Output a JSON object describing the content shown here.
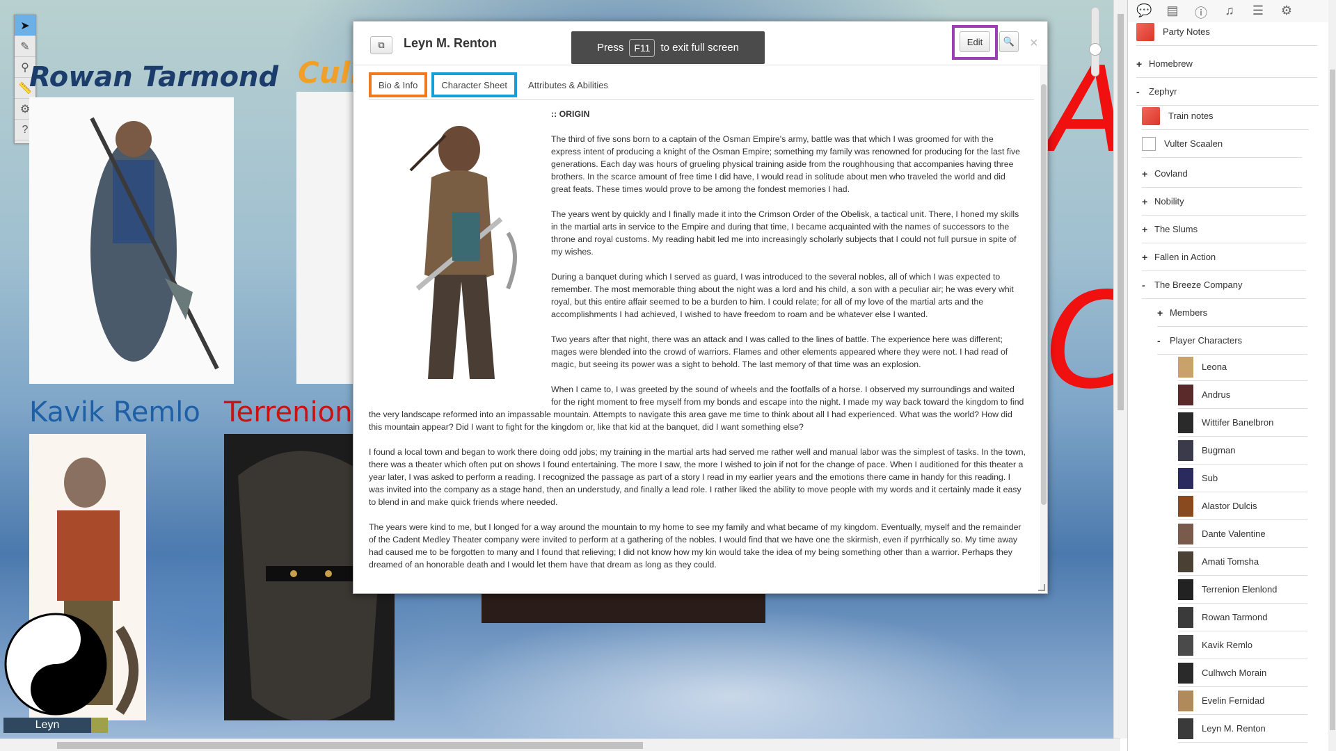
{
  "map": {
    "tokens": [
      {
        "name": "Rowan Tarmond",
        "color": "#1c3d6b"
      },
      {
        "name": "Culhv",
        "color": "#f0a028"
      },
      {
        "name": "Kavik Remlo",
        "color": "#1f5fa6"
      },
      {
        "name": "Terrenion E",
        "color": "#cc1111"
      }
    ],
    "player_token_label": "Leyn",
    "red_scrawl_1": "Al",
    "red_scrawl_2": "Co"
  },
  "fullscreen_banner": {
    "press": "Press",
    "key": "F11",
    "rest": "to exit full screen"
  },
  "handout": {
    "title": "Leyn M. Renton",
    "edit_label": "Edit",
    "close_glyph": "×",
    "tabs": [
      "Bio & Info",
      "Character Sheet",
      "Attributes & Abilities"
    ],
    "section_heading": ":: ORIGIN",
    "paragraphs": [
      "The third of five sons born to a captain of the Osman Empire's army, battle was that which I was groomed for with the express intent of producing a knight of the Osman Empire; something my family was renowned for producing for the last five generations. Each day was hours of grueling physical training aside from the roughhousing that accompanies having three brothers. In the scarce amount of free time I did have, I would read in solitude about men who traveled the world and did great feats. These times would prove to be among the fondest memories I had.",
      "The years went by quickly and I finally made it into the Crimson Order of the Obelisk, a tactical unit. There, I honed my skills in the martial arts in service to the Empire and during that time, I became acquainted with the names of successors to the throne and royal customs. My reading habit led me into increasingly scholarly subjects that I could not full pursue in spite of my wishes.",
      "During a banquet during which I served as guard, I was introduced to the several nobles, all of which I was expected to remember. The most memorable thing about the night was a lord and his child, a son with a peculiar air; he was every whit royal, but this entire affair seemed to be a burden to him. I could relate; for all of my love of the martial arts and the accomplishments I had achieved, I wished to have freedom to roam and be whatever else I wanted.",
      "Two years after that night, there was an attack and I was called to the lines of battle. The experience here was different; mages were blended into the crowd of warriors. Flames and other elements appeared where they were not. I had read of magic, but seeing its power was a sight to behold. The last memory of that time was an explosion.",
      "When I came to, I was greeted by the sound of wheels and the footfalls of a horse. I observed my surroundings and waited for the right moment to free myself from my bonds and escape into the night. I made my way back toward the kingdom to find the very landscape reformed into an impassable mountain. Attempts to navigate this area gave me time to think about all I had experienced. What was the world? How did this mountain appear? Did I want to fight for the kingdom or, like that kid at the banquet, did I want something else?",
      "I found a local town and began to work there doing odd jobs; my training in the martial arts had served me rather well and manual labor was the simplest of tasks. In the town, there was a theater which often put on shows I found entertaining. The more I saw, the more I wished to join if not for the change of pace. When I auditioned for this theater a year later, I was asked to perform a reading. I recognized the passage as part of a story I read in my earlier years and the emotions there came in handy for this reading. I was invited into the company as a stage hand, then an understudy, and finally a lead role. I rather liked the ability to move people with my words and it certainly made it easy to blend in and make quick friends where needed.",
      "The years were kind to me, but I longed for a way around the mountain to my home to see my family and what became of my kingdom. Eventually, myself and the remainder of the Cadent Medley Theater company were invited to perform at a gathering of the nobles. I would find that we have one the skirmish, even if pyrrhically so. My time away had caused me to be forgotten to many and I found that relieving; I did not know how my kin would take the idea of my being something other than a warrior. Perhaps they dreamed of an honorable death and I would let them have that dream as long as they could."
    ]
  },
  "sidebar": {
    "top_icons": [
      "chat-icon",
      "journal-icon",
      "info-icon",
      "jukebox-icon",
      "list-icon",
      "gear-icon"
    ],
    "items": [
      {
        "label": "Party Notes",
        "type": "note",
        "indent": 0
      },
      {
        "label": "Homebrew",
        "type": "folder",
        "sign": "+",
        "indent": 0
      },
      {
        "label": "Zephyr",
        "type": "folder",
        "sign": "-",
        "indent": 0
      },
      {
        "label": "Train notes",
        "type": "note",
        "indent": 1
      },
      {
        "label": "Vulter Scaalen",
        "type": "image",
        "indent": 1
      },
      {
        "label": "Covland",
        "type": "folder",
        "sign": "+",
        "indent": 1
      },
      {
        "label": "Nobility",
        "type": "folder",
        "sign": "+",
        "indent": 1
      },
      {
        "label": "The Slums",
        "type": "folder",
        "sign": "+",
        "indent": 1
      },
      {
        "label": "Fallen in Action",
        "type": "folder",
        "sign": "+",
        "indent": 1
      },
      {
        "label": "The Breeze Company",
        "type": "folder",
        "sign": "-",
        "indent": 1
      },
      {
        "label": "Members",
        "type": "folder",
        "sign": "+",
        "indent": 2
      },
      {
        "label": "Player Characters",
        "type": "folder",
        "sign": "-",
        "indent": 2
      },
      {
        "label": "Leona",
        "type": "char",
        "indent": 3
      },
      {
        "label": "Andrus",
        "type": "char",
        "indent": 3
      },
      {
        "label": "Wittifer Banelbron",
        "type": "char",
        "indent": 3
      },
      {
        "label": "Bugman",
        "type": "char",
        "indent": 3
      },
      {
        "label": "Sub",
        "type": "char",
        "indent": 3
      },
      {
        "label": "Alastor Dulcis",
        "type": "char",
        "indent": 3
      },
      {
        "label": "Dante Valentine",
        "type": "char",
        "indent": 3
      },
      {
        "label": "Amati Tomsha",
        "type": "char",
        "indent": 3
      },
      {
        "label": "Terrenion Elenlond",
        "type": "char",
        "indent": 3
      },
      {
        "label": "Rowan Tarmond",
        "type": "char",
        "indent": 3
      },
      {
        "label": "Kavik Remlo",
        "type": "char",
        "indent": 3
      },
      {
        "label": "Culhwch Morain",
        "type": "char",
        "indent": 3
      },
      {
        "label": "Evelin Fernidad",
        "type": "char",
        "indent": 3
      },
      {
        "label": "Leyn M. Renton",
        "type": "char",
        "indent": 3
      }
    ]
  }
}
